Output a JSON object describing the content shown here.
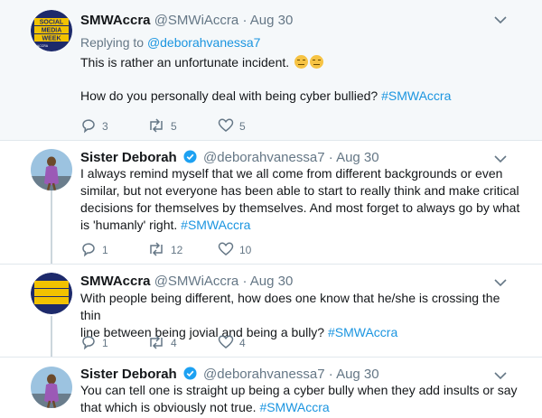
{
  "tweets": [
    {
      "name": "SMWAccra",
      "handle": "@SMWiAccra",
      "sep": "·",
      "date": "Aug 30",
      "avatar": "smw-accra-logo",
      "avatar_lines": [
        "SOCIAL",
        "MEDIA",
        "WEEK",
        "ACCRA"
      ],
      "replying_prefix": "Replying to",
      "replying_to": "@deborahvanessa7",
      "text_lines": [
        "This is rather an unfortunate incident.",
        "How do you personally deal with being cyber bullied?"
      ],
      "hashtag": "#SMWAccra",
      "reply_count": "3",
      "retweet_count": "5",
      "like_count": "5"
    },
    {
      "name": "Sister Deborah",
      "verified": true,
      "handle": "@deborahvanessa7",
      "sep": "·",
      "date": "Aug 30",
      "avatar": "sister-deborah-photo",
      "text_lines": [
        "I always remind myself that we all come from different backgrounds or even",
        "similar, but not everyone has been able to start to really think and make critical",
        "decisions for themselves by themselves. And most forget to always go by what",
        "is 'humanly' right."
      ],
      "hashtag": "#SMWAccra",
      "reply_count": "1",
      "retweet_count": "12",
      "like_count": "10"
    },
    {
      "name": "SMWAccra",
      "handle": "@SMWiAccra",
      "sep": "·",
      "date": "Aug 30",
      "avatar": "smw-accra-logo",
      "text_lines": [
        "With people being different, how does one know that he/she is crossing the thin",
        "line between being jovial and being a bully?"
      ],
      "hashtag": "#SMWAccra",
      "reply_count": "1",
      "retweet_count": "4",
      "like_count": "4"
    },
    {
      "name": "Sister Deborah",
      "verified": true,
      "handle": "@deborahvanessa7",
      "sep": "·",
      "date": "Aug 30",
      "avatar": "sister-deborah-photo",
      "text_lines": [
        "You can tell one is straight up being a cyber bully when they add insults or say",
        "that which is obviously not true."
      ],
      "hashtag": "#SMWAccra"
    }
  ],
  "icons": {
    "reply": "reply-icon",
    "retweet": "retweet-icon",
    "like": "heart-icon",
    "menu": "chevron-down-icon",
    "verified": "verified-badge-icon"
  },
  "colors": {
    "link": "#1b95e0",
    "muted": "#657786",
    "highlight_bg": "#f5f8fa",
    "divider": "#e1e8ed"
  }
}
